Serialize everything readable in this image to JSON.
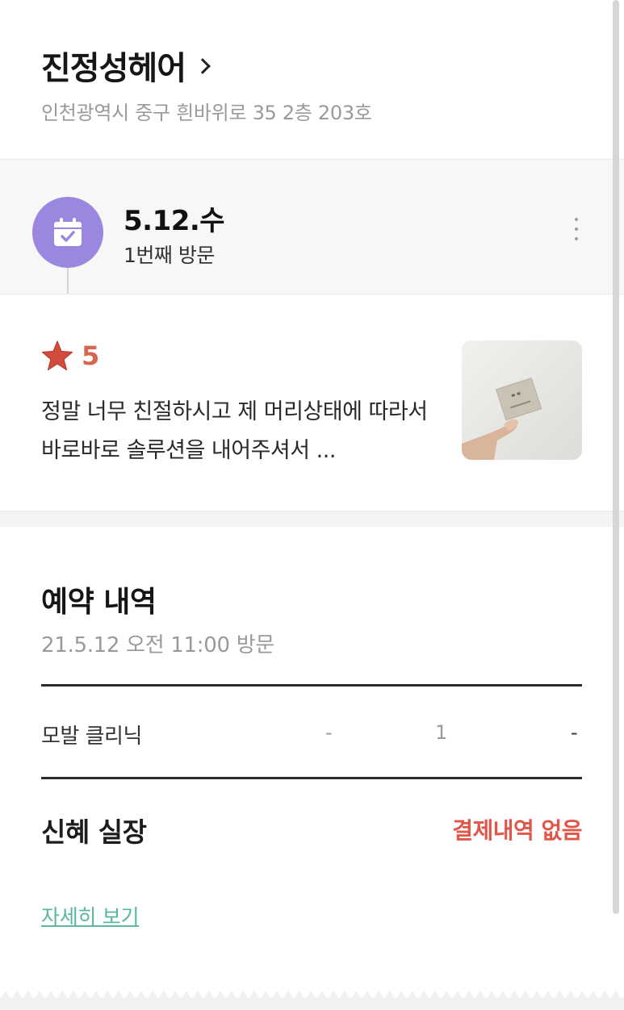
{
  "shop": {
    "name": "진정성헤어",
    "address": "인천광역시 중구 흰바위로 35 2층 203호"
  },
  "visit": {
    "date": "5.12.수",
    "count": "1번째 방문",
    "icon": "calendar-check-icon",
    "icon_bg": "#9b87e0"
  },
  "review": {
    "rating": "5",
    "rating_max": 5,
    "text": "정말 너무 친절하시고 제 머리상태에 따라서 바로바로 솔루션을 내어주셔서 ...",
    "star_color": "#d24c3e"
  },
  "reservation": {
    "title": "예약 내역",
    "datetime": "21.5.12 오전 11:00 방문",
    "services": [
      {
        "name": "모발 클리닉",
        "col1": "-",
        "col2": "1",
        "col3": "-"
      }
    ],
    "staff": "신혜 실장",
    "payment_status": "결제내역 없음",
    "detail_link": "자세히 보기"
  },
  "colors": {
    "accent_purple": "#9b87e0",
    "payment_red": "#e0574a",
    "link_green": "#5bb6a0",
    "rating_orange": "#d8654f"
  }
}
